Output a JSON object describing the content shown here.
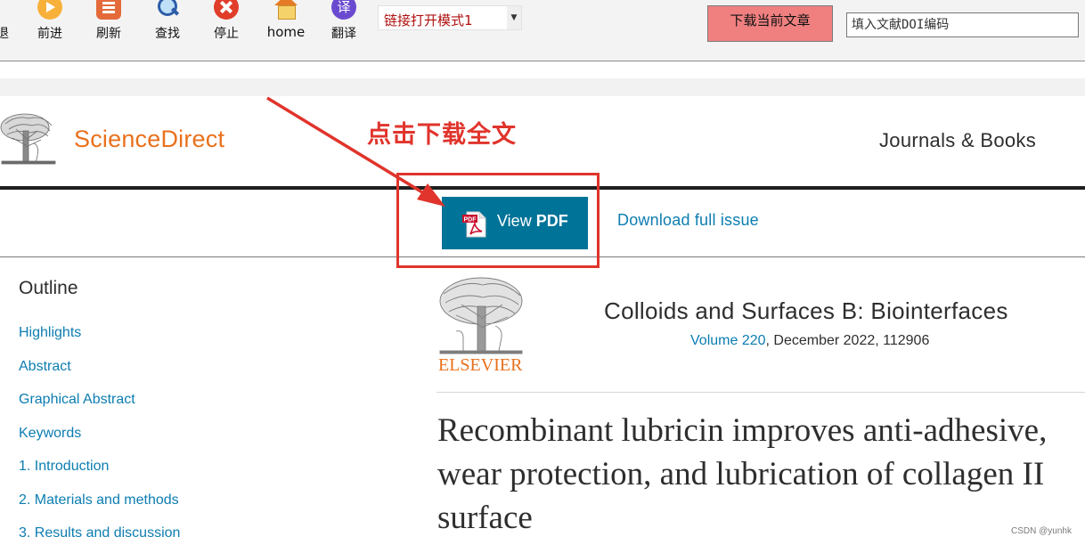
{
  "toolbar": {
    "cut_label": "退",
    "buttons": [
      {
        "id": "forward",
        "label": "前进",
        "icon": "forward-arrow-icon"
      },
      {
        "id": "refresh",
        "label": "刷新",
        "icon": "refresh-icon"
      },
      {
        "id": "find",
        "label": "查找",
        "icon": "magnifier-icon"
      },
      {
        "id": "stop",
        "label": "停止",
        "icon": "stop-icon"
      },
      {
        "id": "home",
        "label": "home",
        "icon": "home-icon"
      },
      {
        "id": "translate",
        "label": "翻译",
        "icon": "translate-icon",
        "glyph": "译"
      }
    ],
    "mode_select": {
      "value": "链接打开模式1"
    },
    "download_button": "下载当前文章",
    "doi_input": {
      "value": "",
      "placeholder": "填入文献DOI编码"
    }
  },
  "header": {
    "brand": "ScienceDirect",
    "nav_link": "Journals & Books",
    "brand_color": "#e9711c"
  },
  "annotation": {
    "text": "点击下载全文",
    "color": "#e0342c"
  },
  "pdf_bar": {
    "view_pdf_prefix": "View",
    "view_pdf_bold": "PDF",
    "pdf_icon_text": "PDF",
    "download_issue": "Download full issue",
    "accent": "#007398"
  },
  "outline": {
    "title": "Outline",
    "items": [
      "Highlights",
      "Abstract",
      "Graphical Abstract",
      "Keywords",
      "1. Introduction",
      "2. Materials and methods",
      "3. Results and discussion"
    ]
  },
  "journal": {
    "publisher_logo_text": "ELSEVIER",
    "title": "Colloids and Surfaces B: Biointerfaces",
    "volume_link": "Volume 220",
    "issue_details": ", December 2022, 112906"
  },
  "article": {
    "title_lines": [
      "Recombinant lubricin improves anti-adhesive,",
      "wear protection, and lubrication of collagen II",
      "surface"
    ]
  },
  "watermark": "CSDN @yunhk"
}
